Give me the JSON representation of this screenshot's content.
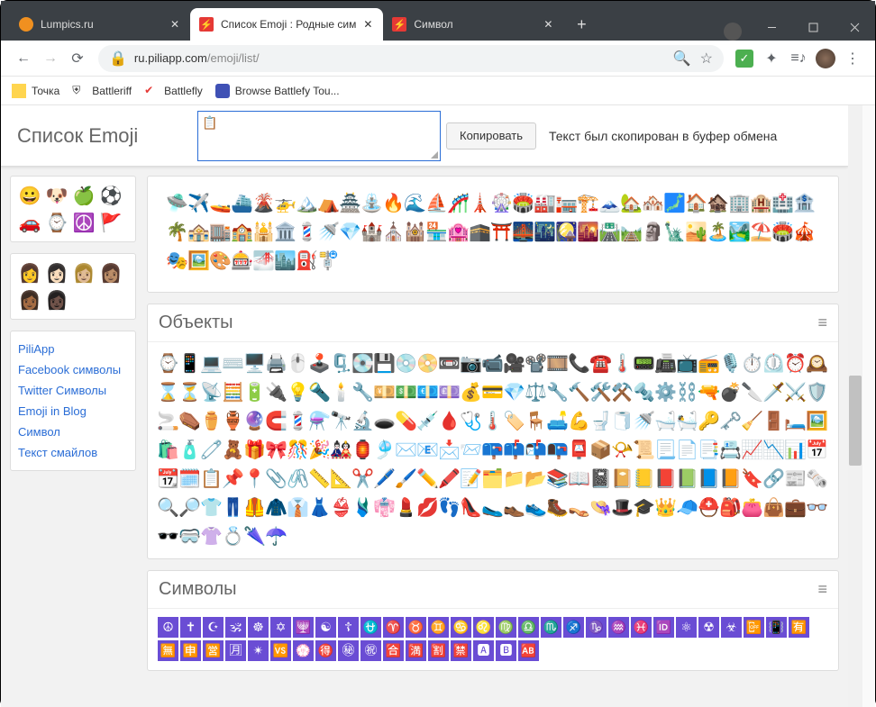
{
  "browser": {
    "tabs": [
      {
        "title": "Lumpics.ru",
        "favicon": "#f09020",
        "active": false
      },
      {
        "title": "Список Emoji : Родные сим",
        "favicon": "#e53935",
        "active": true
      },
      {
        "title": "Символ",
        "favicon": "#e53935",
        "active": false
      }
    ],
    "url_host": "ru.piliapp.com",
    "url_path": "/emoji/list/",
    "bookmarks": [
      {
        "label": "Точка",
        "color": "#ffd54f"
      },
      {
        "label": "Battleriff",
        "color": "#333"
      },
      {
        "label": "Battlefly",
        "color": "#e53935"
      },
      {
        "label": "Browse Battlefy Tou...",
        "color": "#3f51b5"
      }
    ]
  },
  "page": {
    "title": "Список Emoji",
    "textarea_value": "📋",
    "copy_button": "Копировать",
    "status": "Текст был скопирован в буфер обмена"
  },
  "sidebar": {
    "emoji1": [
      "😀",
      "🐶",
      "🍏",
      "⚽",
      "🚗",
      "⌚",
      "☮️",
      "🚩"
    ],
    "emoji2": [
      "👩",
      "👩🏻",
      "👩🏼",
      "👩🏽",
      "👩🏾",
      "👩🏿"
    ],
    "links": [
      "PiliApp",
      "Facebook символы",
      "Twitter Символы",
      "Emoji in Blog",
      "Символ",
      "Текст смайлов"
    ]
  },
  "sections": {
    "travel_row1": [
      "🛸",
      "✈️",
      "🚤",
      "⛴️",
      "🌋",
      "🚁",
      "🏔️",
      "⛺",
      "🏯",
      "⛲",
      "🔥",
      "🌊",
      "⛵",
      "🎢",
      "🗼",
      "🎡",
      "🏟️",
      "🏭",
      "🏣",
      "🏗️",
      "🗻"
    ],
    "travel_row2": [
      "🏡",
      "🏘️",
      "🗾",
      "🏠",
      "🏚️",
      "🏢",
      "🏨",
      "🏥",
      "🏦",
      "🌴",
      "🏤",
      "🏬",
      "🏫",
      "🕌",
      "🏛️",
      "💈",
      "🚿",
      "💎",
      "🏰",
      "⛪",
      "🕍",
      "🏪",
      "🏩",
      "🕋",
      "⛩️",
      "🌉",
      "🌃",
      "🎑",
      "🌇",
      "🛣️",
      "🛤️"
    ],
    "travel_row3": [
      "🗿",
      "🗽",
      "🏜️",
      "🏝️",
      "🏞️",
      "⛱️",
      "🏟️",
      "🎪",
      "🎭",
      "🖼️",
      "🎨",
      "🎰",
      "🌁",
      "🏙️",
      "⛽",
      "🚏"
    ],
    "objects_title": "Объекты",
    "objects": [
      "⌚",
      "📱",
      "💻",
      "⌨️",
      "🖥️",
      "🖨️",
      "🖱️",
      "🕹️",
      "🗜️",
      "💽",
      "💾",
      "💿",
      "📀",
      "📼",
      "📷",
      "📹",
      "🎥",
      "📽️",
      "🎞️",
      "📞",
      "☎️",
      "🌡️",
      "📟",
      "📠",
      "📺",
      "📻",
      "🎙️",
      "⏱️",
      "⏲️",
      "⏰",
      "🕰️",
      "⌛",
      "⏳",
      "📡",
      "🧮",
      "🔋",
      "🔌",
      "💡",
      "🔦",
      "🕯️",
      "🔧",
      "💴",
      "💵",
      "💶",
      "💷",
      "💰",
      "💳",
      "💎",
      "⚖️",
      "🔧",
      "🔨",
      "🛠️",
      "⚒️",
      "🔩",
      "⚙️",
      "⛓️",
      "🔫",
      "💣",
      "🔪",
      "🗡️",
      "⚔️",
      "🛡️",
      "🚬",
      "⚰️",
      "⚱️",
      "🏺",
      "🔮",
      "🧲",
      "💈",
      "⚗️",
      "🔭",
      "🔬",
      "🕳️",
      "💊",
      "💉",
      "🩸",
      "🩺",
      "🌡️",
      "🏷️",
      "🪑",
      "🛋️",
      "💪",
      "🚽",
      "🧻",
      "🚿",
      "🛁",
      "🛀",
      "🔑",
      "🗝️",
      "🧹",
      "🚪",
      "🛏️",
      "🖼️",
      "🛍️",
      "🧴",
      "🧷",
      "🧸",
      "🎁",
      "🎀",
      "🎊",
      "🎉",
      "🎎",
      "🏮",
      "🎐",
      "✉️",
      "📧",
      "📩",
      "📨",
      "📪",
      "📫",
      "📬",
      "📭",
      "📮",
      "📦",
      "📯",
      "📜",
      "📃",
      "📄",
      "📑",
      "📇",
      "📈",
      "📉",
      "📊",
      "📅",
      "📆",
      "🗓️",
      "📋",
      "📌",
      "📍",
      "📎",
      "🖇️",
      "📏",
      "📐",
      "✂️",
      "🖊️",
      "🖌️",
      "✏️",
      "🖍️",
      "📝",
      "🗂️",
      "📁",
      "📂",
      "📚",
      "📖",
      "📓",
      "📔",
      "📒",
      "📕",
      "📗",
      "📘",
      "📙",
      "🔖",
      "🔗",
      "📰",
      "🗞️",
      "🔍",
      "🔎",
      "👕",
      "👖",
      "🦺",
      "🧥",
      "👔",
      "👗",
      "👙",
      "🩱",
      "👘",
      "💄",
      "💋",
      "👣",
      "👠",
      "🥿",
      "👞",
      "👟",
      "🥾",
      "👡",
      "👒",
      "🎩",
      "🎓",
      "👑",
      "🧢",
      "⛑️",
      "🎒",
      "👛",
      "👜",
      "💼",
      "👓",
      "🕶️",
      "🥽",
      "👚",
      "💍",
      "🌂",
      "☂️"
    ],
    "symbols_title": "Символы",
    "symbols": [
      "☮",
      "✝",
      "☪",
      "🕉",
      "☸",
      "✡",
      "🕎",
      "☯",
      "☦",
      "⛎",
      "♈",
      "♉",
      "♊",
      "♋",
      "♌",
      "♍",
      "♎",
      "♏",
      "♐",
      "♑",
      "♒",
      "♓",
      "🆔",
      "⚛",
      "☢",
      "☣",
      "📴",
      "📳",
      "🈶",
      "🈚",
      "🈸",
      "🈺",
      "🈷",
      "✴",
      "🆚",
      "💮",
      "🉐",
      "㊙",
      "㊗",
      "🈴",
      "🈵",
      "🈹",
      "🈲",
      "🅰",
      "🅱",
      "🆎"
    ]
  }
}
